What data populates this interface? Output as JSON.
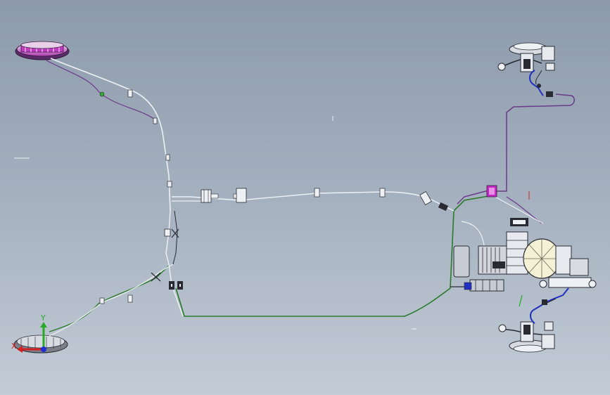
{
  "viewport": {
    "background_top": "#8d9aab",
    "background_bottom": "#c3ccd6"
  },
  "colors": {
    "line_white": "#eef1f4",
    "line_green": "#2a7a2a",
    "line_purple": "#6a3a8a",
    "line_magenta": "#b02ab0",
    "line_blue": "#2030c0",
    "line_dark": "#2a2a33",
    "axis_x": "#d42020",
    "axis_y": "#2aa82a",
    "axis_z": "#2030d0"
  },
  "triad": {
    "x_label": "X",
    "y_label": "Y",
    "icon": "coordinate-triad-icon"
  }
}
